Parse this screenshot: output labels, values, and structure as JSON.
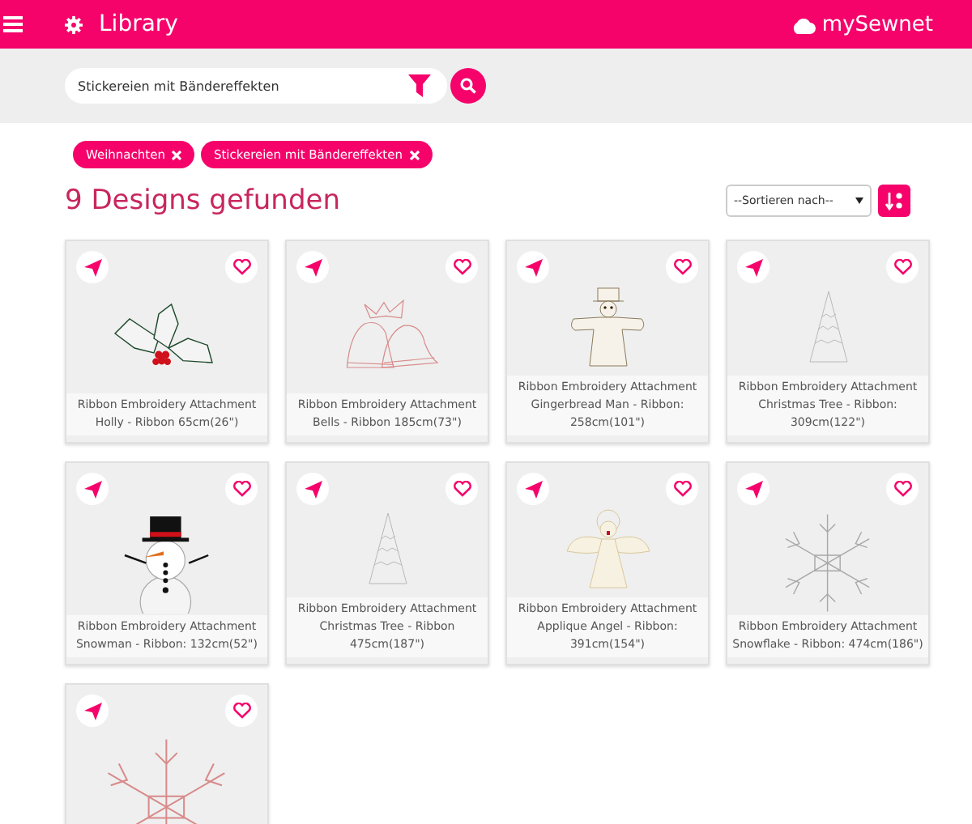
{
  "header": {
    "title": "Library",
    "brand": "mySewnet"
  },
  "search": {
    "value": "Stickereien mit Bändereffekten"
  },
  "filters": [
    {
      "label": "Weihnachten"
    },
    {
      "label": "Stickereien mit Bändereffekten"
    }
  ],
  "results_heading": "9 Designs gefunden",
  "sort": {
    "value": "--Sortieren nach--"
  },
  "designs": [
    {
      "kind": "holly",
      "caption": "Ribbon Embroidery Attachment Holly - Ribbon 65cm(26\")"
    },
    {
      "kind": "bells",
      "caption": "Ribbon Embroidery Attachment Bells - Ribbon 185cm(73\")"
    },
    {
      "kind": "gingerbread",
      "caption": "Ribbon Embroidery Attachment Gingerbread Man - Ribbon: 258cm(101\")"
    },
    {
      "kind": "tree",
      "caption": "Ribbon Embroidery Attachment Christmas Tree - Ribbon: 309cm(122\")"
    },
    {
      "kind": "snowman",
      "caption": "Ribbon Embroidery Attachment Snowman - Ribbon: 132cm(52\")"
    },
    {
      "kind": "tree",
      "caption": "Ribbon Embroidery Attachment Christmas Tree - Ribbon 475cm(187\")"
    },
    {
      "kind": "angel",
      "caption": "Ribbon Embroidery Attachment Applique Angel - Ribbon: 391cm(154\")"
    },
    {
      "kind": "snowflake",
      "caption": "Ribbon Embroidery Attachment Snowflake - Ribbon: 474cm(186\")"
    },
    {
      "kind": "snowflake-red"
    }
  ]
}
